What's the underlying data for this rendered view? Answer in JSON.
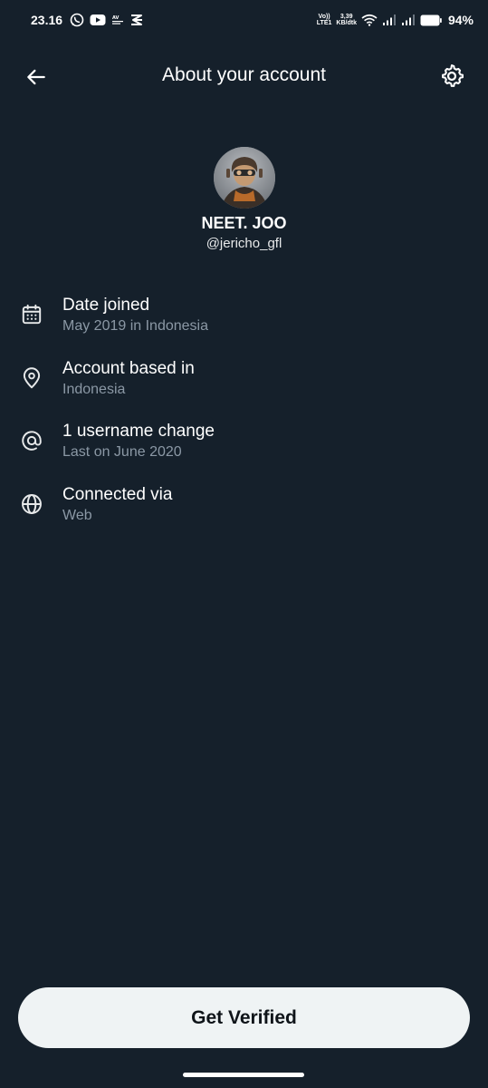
{
  "status_bar": {
    "time": "23.16",
    "net_top": "Vo))",
    "net_bottom": "LTE1",
    "speed_value": "3,39",
    "speed_unit": "KB/dtk",
    "battery_percent": "94%",
    "icons": [
      "whatsapp-icon",
      "youtube-icon",
      "news-icon",
      "capcut-icon",
      "wifi-icon",
      "signal-icon",
      "signal-icon",
      "battery-icon"
    ]
  },
  "header": {
    "title": "About your account",
    "back_icon": "arrow-left-icon",
    "settings_icon": "gear-icon"
  },
  "profile": {
    "display_name": "NEET. JOO",
    "handle": "@jericho_gfl"
  },
  "info_items": [
    {
      "icon": "calendar-icon",
      "title": "Date joined",
      "subtitle": "May 2019 in Indonesia"
    },
    {
      "icon": "location-pin-icon",
      "title": "Account based in",
      "subtitle": "Indonesia"
    },
    {
      "icon": "at-sign-icon",
      "title": "1 username change",
      "subtitle": "Last on June 2020"
    },
    {
      "icon": "globe-icon",
      "title": "Connected via",
      "subtitle": "Web"
    }
  ],
  "cta": {
    "label": "Get Verified"
  },
  "colors": {
    "background": "#15202b",
    "text_primary": "#ffffff",
    "text_secondary": "#8b98a5",
    "button_bg": "#eff3f4",
    "button_text": "#0f1419"
  }
}
